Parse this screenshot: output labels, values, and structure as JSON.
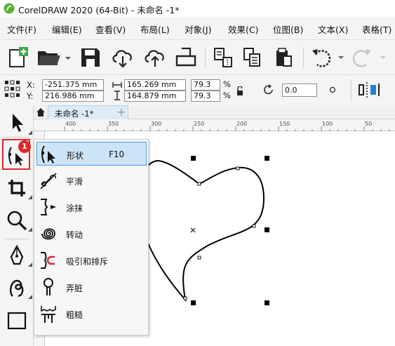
{
  "title": "CorelDRAW 2020 (64-Bit) - 未命名 -1*",
  "menus": [
    "文件(F)",
    "编辑(E)",
    "查看(V)",
    "布局(L)",
    "对象(J)",
    "效果(C)",
    "位图(B)",
    "文本(X)",
    "表格(T)"
  ],
  "props": {
    "x_label": "X:",
    "y_label": "Y:",
    "x": "-251.375 mm",
    "y": "216.986 mm",
    "w": "165.269 mm",
    "h": "164.879 mm",
    "sx": "79.3",
    "sy": "79.3",
    "pct": "%",
    "rotation": "0.0"
  },
  "tab": {
    "label": "未命名 -1*",
    "add": "+"
  },
  "ruler_ticks": [
    "400",
    "350",
    "300",
    "250",
    "200",
    "150",
    "100",
    "50"
  ],
  "badge": "1",
  "flyout": [
    {
      "label": "形状",
      "key": "F10",
      "icon": "shape-tool-icon"
    },
    {
      "label": "平滑",
      "icon": "smooth-tool-icon"
    },
    {
      "label": "涂抹",
      "icon": "smear-tool-icon"
    },
    {
      "label": "转动",
      "icon": "twirl-tool-icon"
    },
    {
      "label": "吸引和排斥",
      "icon": "attract-repel-tool-icon"
    },
    {
      "label": "弄脏",
      "icon": "smudge-tool-icon"
    },
    {
      "label": "粗糙",
      "icon": "roughen-tool-icon"
    }
  ],
  "colors": {
    "highlight": "#cce4f7",
    "highlight_border": "#4a9fe0",
    "badge": "#e0262c",
    "callout": "#e0262c"
  }
}
